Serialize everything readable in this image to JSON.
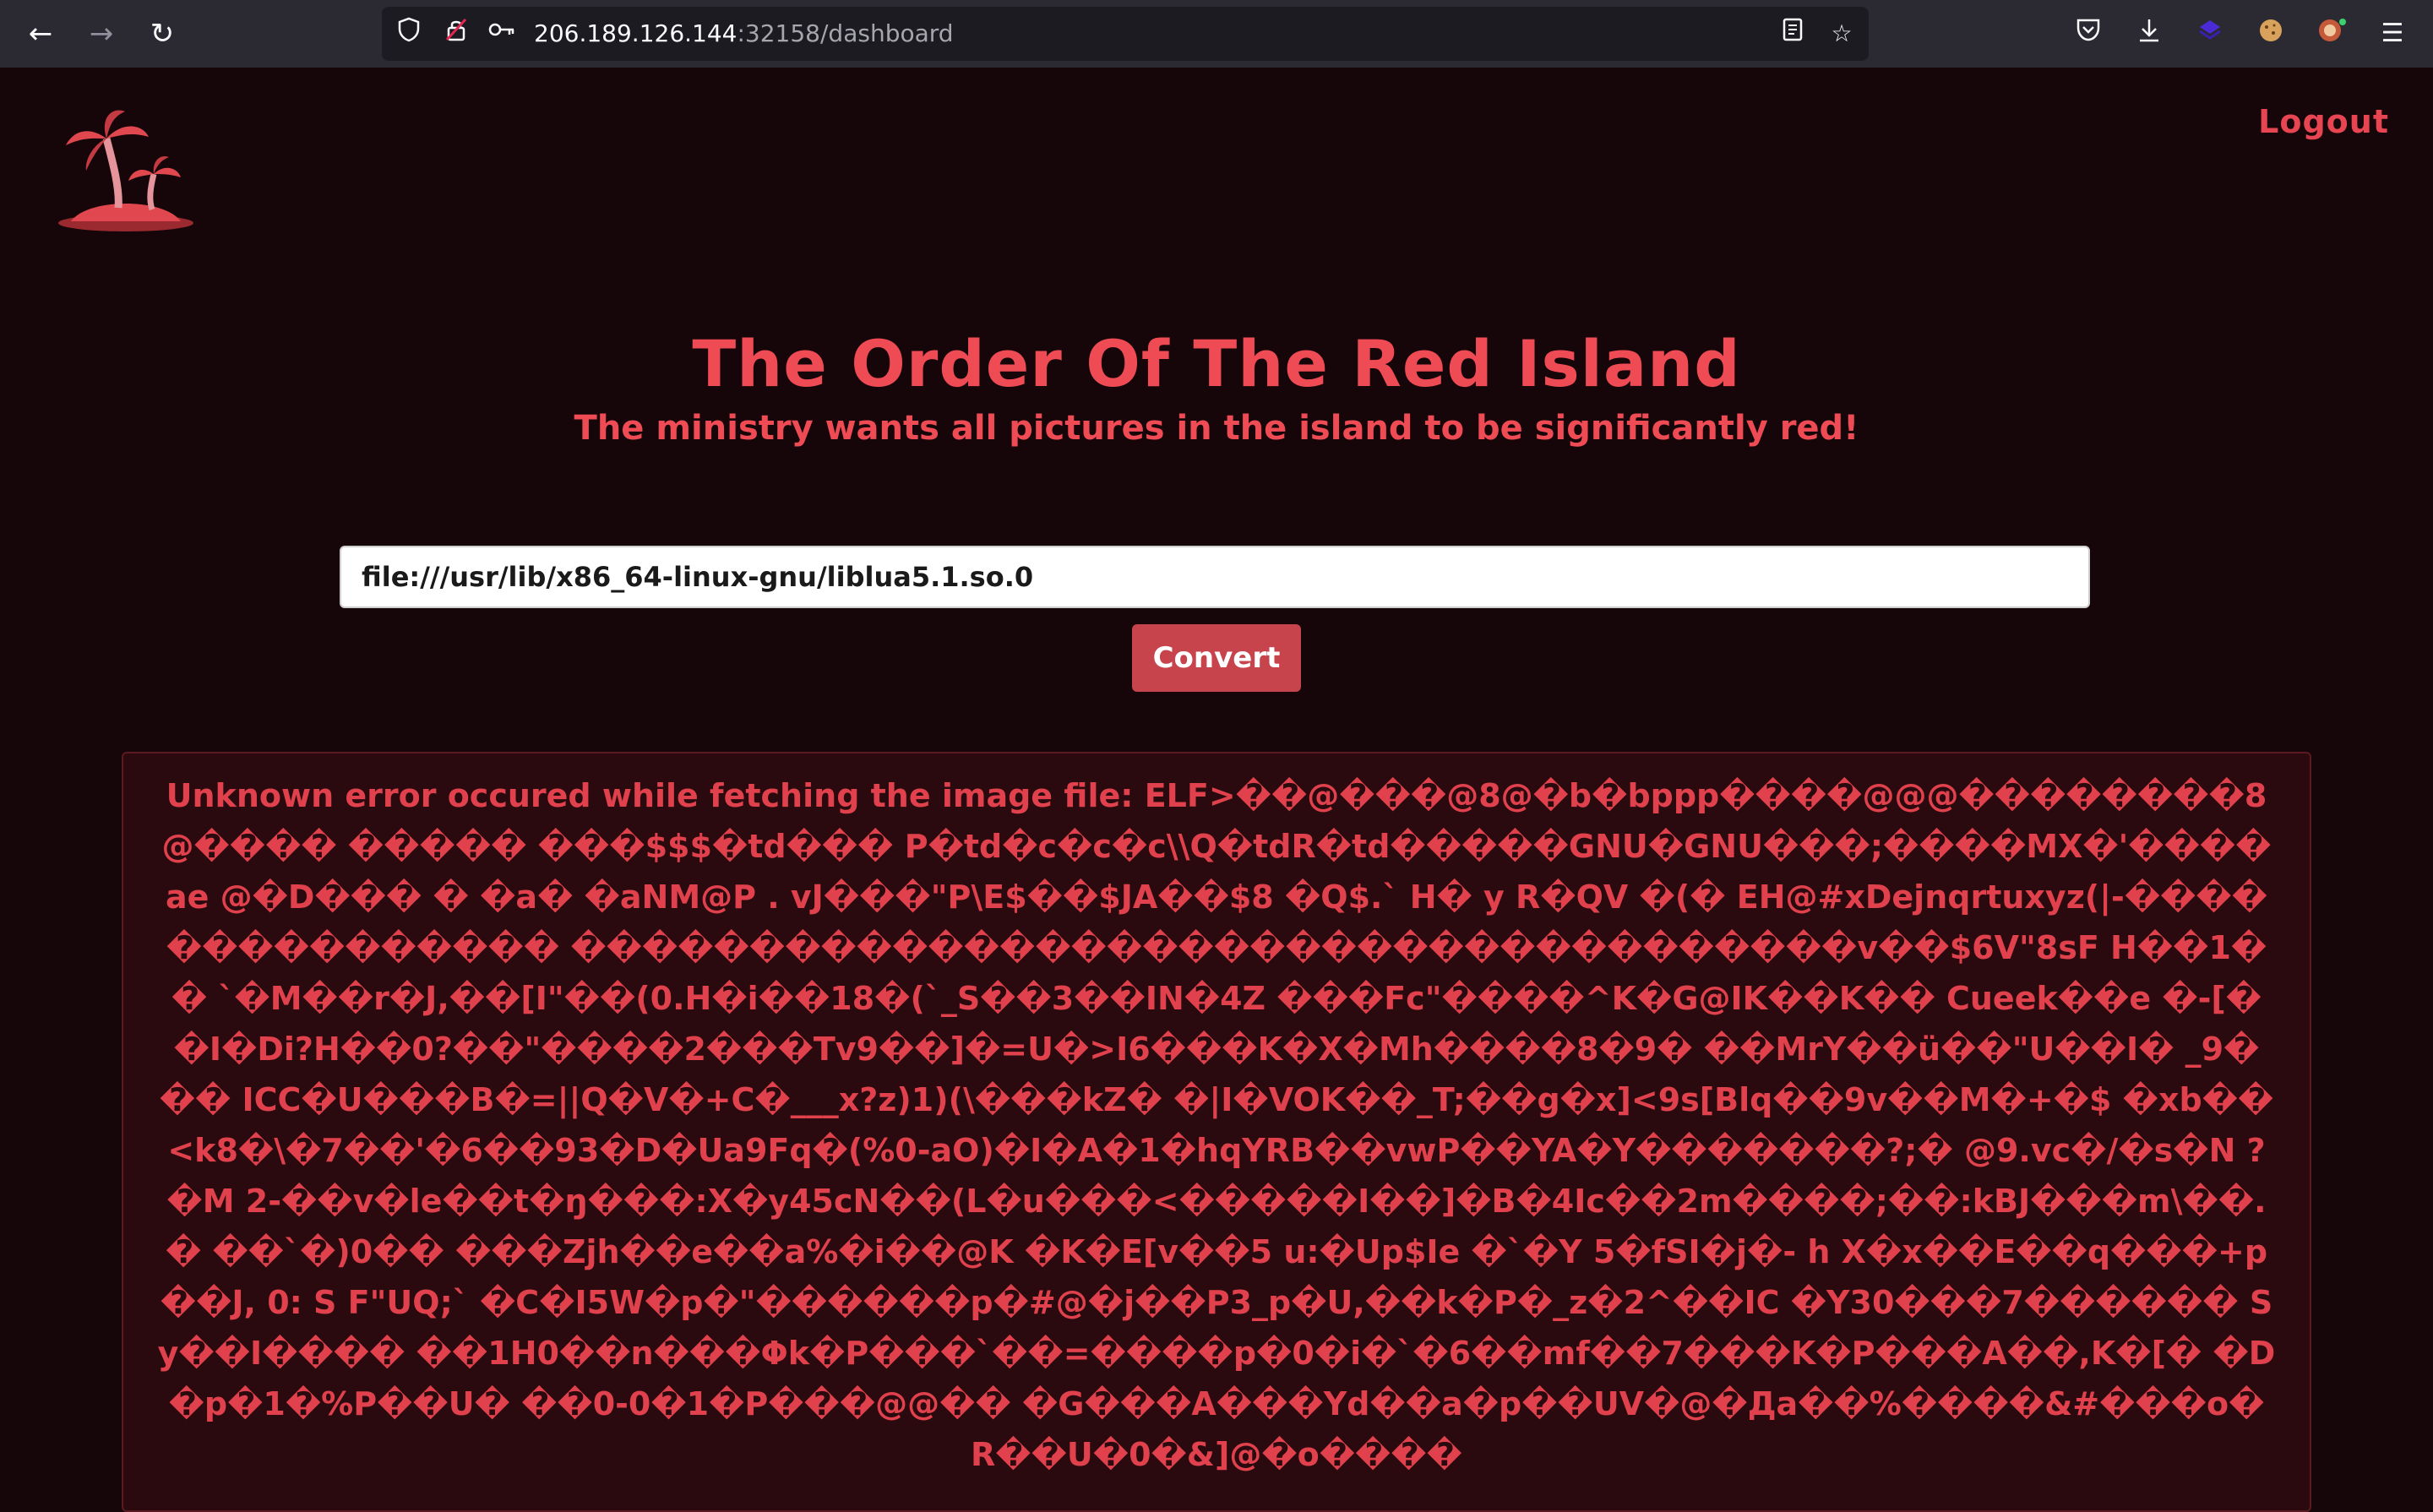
{
  "browser": {
    "url_host": "206.189.126.144",
    "url_rest": ":32158/dashboard",
    "icons": {
      "back": "back-arrow-icon",
      "forward": "forward-arrow-icon",
      "reload": "reload-icon",
      "shield": "shield-icon",
      "lock": "insecure-lock-icon",
      "key": "key-icon",
      "reader": "reader-view-icon",
      "bookmark": "star-icon",
      "pocket": "pocket-icon",
      "downloads": "download-icon",
      "menu": "hamburger-menu-icon"
    }
  },
  "header": {
    "logout_label": "Logout"
  },
  "hero": {
    "title": "The Order Of The Red Island",
    "subtitle": "The ministry wants all pictures in the island to be significantly red!"
  },
  "form": {
    "url_value": "file:///usr/lib/x86_64-linux-gnu/liblua5.1.so.0",
    "convert_label": "Convert"
  },
  "result": {
    "text": "Unknown error occured while fetching the image file: ELF>��@���@8@�b�bppp����@@@��������8@���� ����� ���$$$�td��� P�td�c�c�c\\\\Q�tdR�td�����GNU�GNU���;����MX�'����ae @�D��� � �a� �aNM@P . vJ���\"P\\E$��$JA��$8 �Q$.` H� y R�QV �(� EH@#xDejnqrtuxyz(|-��������������� ������������������������������������v��$6V\"8sF H��1�� `�M��r�J,��[I\"��(0.H�i��18�(`_S��3��IN�4Z ���Fc\"����^K�G@IK��K�� Cueek��e �-[��I�Di?H��0?��\"����2���Tv9��]�=U�>I6���K�X�Mh����8�9� ��MrY��ü��\"U��I� _9��� ICC�U���B�=||Q�V�+C�___x?z)1)(\\���kZ� �|I�VOK��_T;��g�x]<9s[Blq��9v��M�+�$ �xb��<k8�\\�7��'�6��93�D�Ua9Fq�(%0-aO)�I�A�1�hqYRB��vwP��YA�Y�������?;� @9.vc�/�s�N ?�M 2-��v�le��t�ŋ���:X�y45cN��(L�u���<�����I��]�B�4Ic��2m����;��:kBJ���m\\��.� ��`�)0�� ���Zjh��e��a%�i��@K �K�E[v��5 u:�Up$Ie �`�Y 5�fSI�j�- h X�x��E��q���+p��J, 0: S F\"UQ;` �C�I5W�p�\"������p�#@�j��P3_p�U,��k�P�_z�2^��IC �Y30���7������ Sy��I���� ��1H0��n���Φk�P���`��=����p�0�i�`�6��mf��7���K�P���A��,K�[� �D�p�1�%P��U� ��0-0�1�P���@@�� �G���A���Yd��a�p��UV�@�Да��%����&#���o� R��U�0�&]@�o����"
  }
}
